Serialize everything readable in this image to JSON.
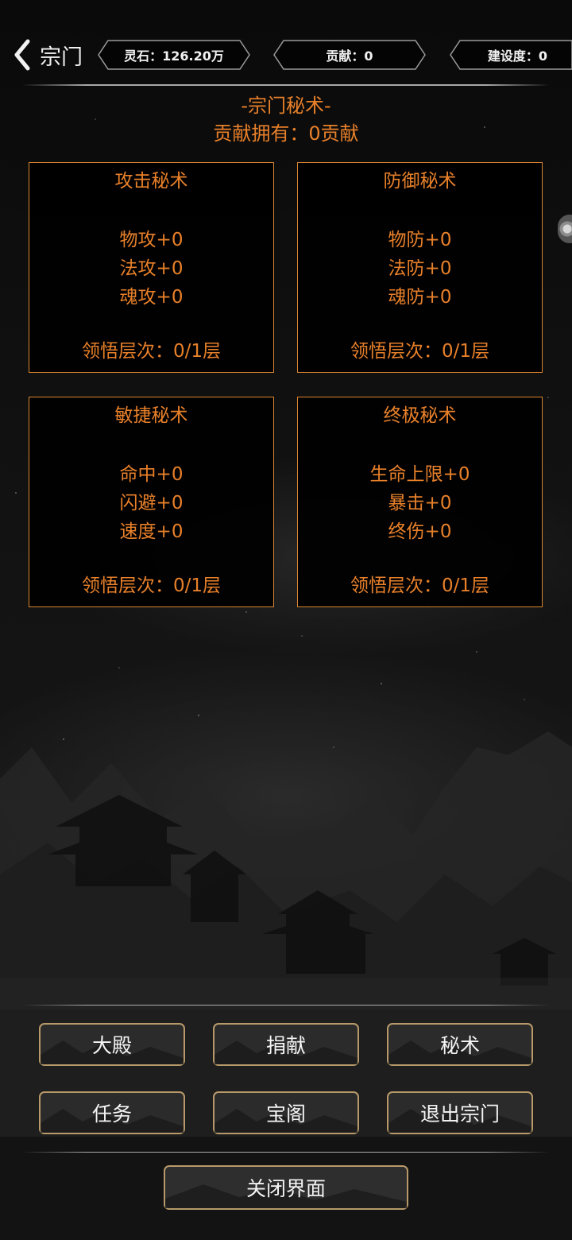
{
  "header": {
    "back_label": "宗门",
    "stats": [
      {
        "id": "spirit-stone",
        "text": "灵石：126.20万"
      },
      {
        "id": "contribution",
        "text": "贡献：0"
      },
      {
        "id": "construction",
        "text": "建设度：0"
      }
    ]
  },
  "main": {
    "title": "-宗门秘术-",
    "owned_text": "贡献拥有：0贡献",
    "panels": [
      {
        "title": "攻击秘术",
        "stats": [
          "物攻+0",
          "法攻+0",
          "魂攻+0"
        ],
        "level": "领悟层次：0/1层"
      },
      {
        "title": "防御秘术",
        "stats": [
          "物防+0",
          "法防+0",
          "魂防+0"
        ],
        "level": "领悟层次：0/1层"
      },
      {
        "title": "敏捷秘术",
        "stats": [
          "命中+0",
          "闪避+0",
          "速度+0"
        ],
        "level": "领悟层次：0/1层"
      },
      {
        "title": "终极秘术",
        "stats": [
          "生命上限+0",
          "暴击+0",
          "终伤+0"
        ],
        "level": "领悟层次：0/1层"
      }
    ]
  },
  "bottom_menu": {
    "buttons": [
      "大殿",
      "捐献",
      "秘术",
      "任务",
      "宝阁",
      "退出宗门"
    ],
    "close_label": "关闭界面"
  },
  "colors": {
    "accent": "#e8802a",
    "panel_border": "#d9852f",
    "background": "#111111",
    "text": "#f0f0f0"
  },
  "icons": {
    "back": "chevron-left-icon",
    "side_handle": "side-handle-icon"
  }
}
